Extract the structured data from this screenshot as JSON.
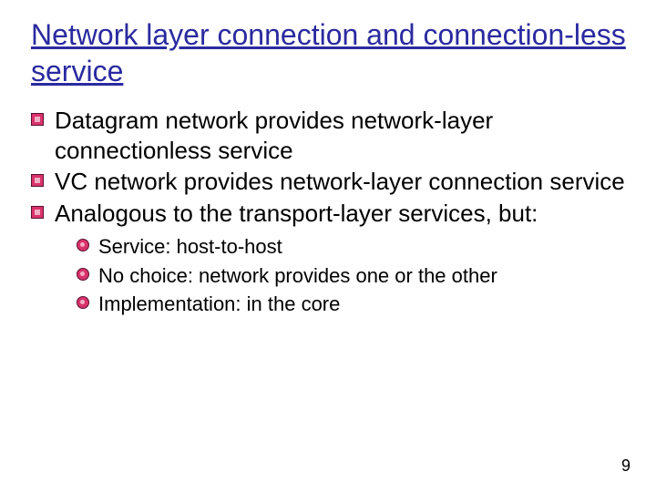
{
  "title": "Network layer connection and connection-less service",
  "bullets": [
    {
      "text": "Datagram network provides network-layer connectionless service"
    },
    {
      "text": "VC network provides network-layer connection service"
    },
    {
      "text": "Analogous to the transport-layer services, but:"
    }
  ],
  "subbullets": [
    {
      "text": "Service: host-to-host"
    },
    {
      "text": "No choice: network provides one or the other"
    },
    {
      "text": "Implementation: in the core"
    }
  ],
  "page_number": "9"
}
